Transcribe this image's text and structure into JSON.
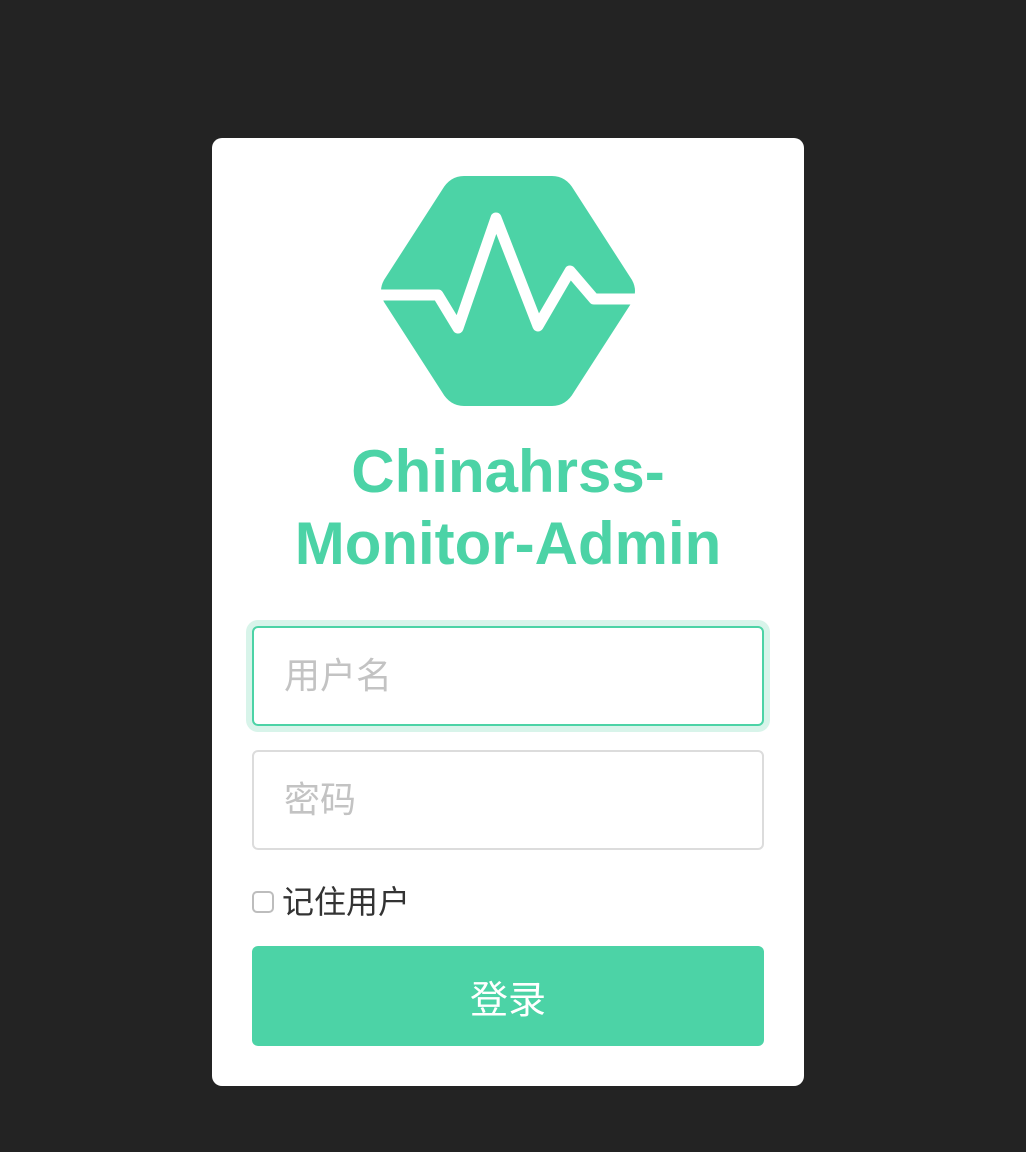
{
  "theme": {
    "accent": "#4cd3a6",
    "background": "#232323",
    "card": "#ffffff"
  },
  "logo": {
    "icon": "heartbeat-hexagon-icon"
  },
  "title": {
    "line1": "Chinahrss-",
    "line2": "Monitor-Admin"
  },
  "form": {
    "username_placeholder": "用户名",
    "username_value": "",
    "password_placeholder": "密码",
    "password_value": "",
    "remember_label": "记住用户",
    "remember_checked": false,
    "login_label": "登录"
  }
}
